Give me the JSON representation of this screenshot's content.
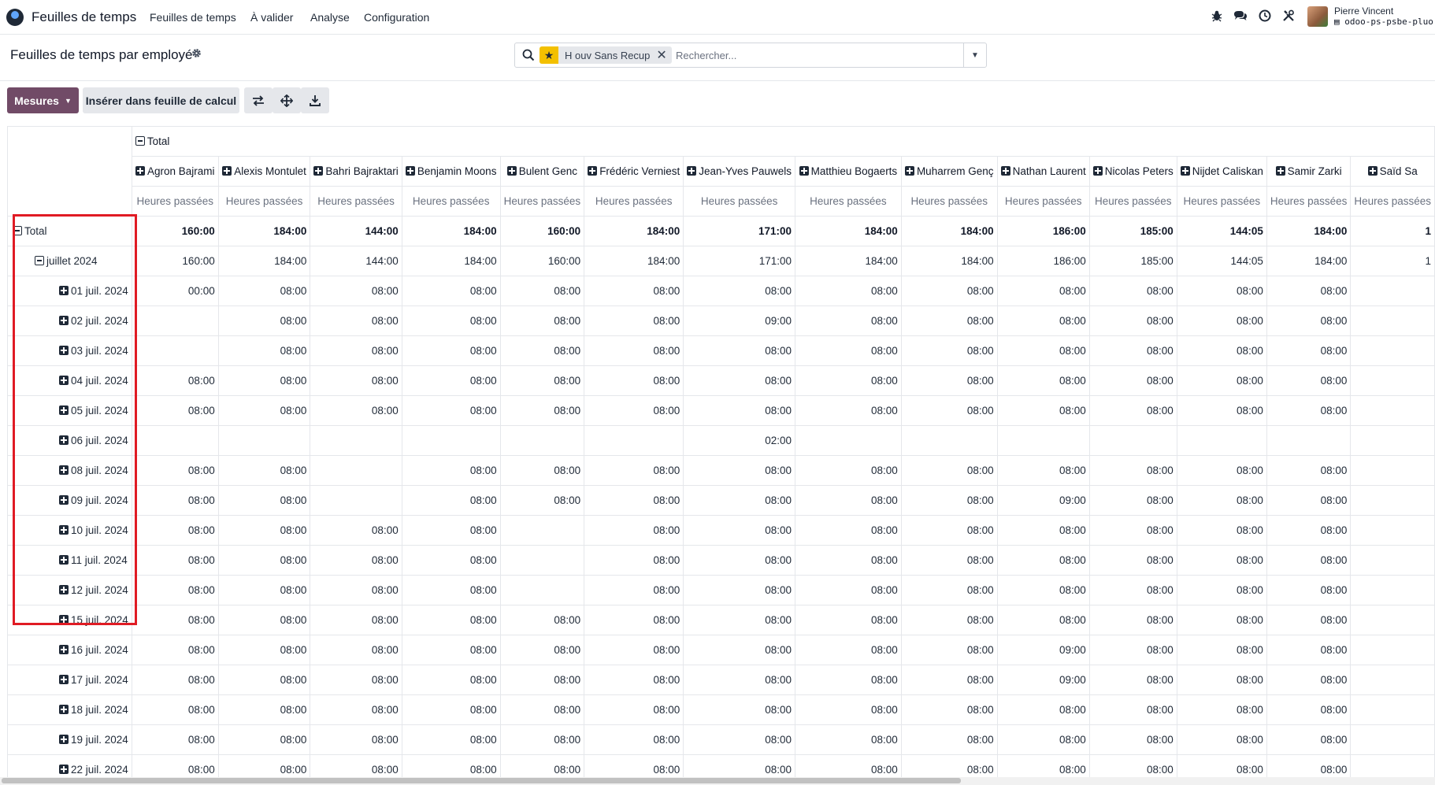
{
  "navbar": {
    "app_name": "Feuilles de temps",
    "menus": [
      "Feuilles de temps",
      "À valider",
      "Analyse",
      "Configuration"
    ],
    "user_name": "Pierre Vincent",
    "user_db": "odoo-ps-psbe-pluo",
    "db_prefix": "▤",
    "icons": [
      "bug-icon",
      "chat-icon",
      "clock-icon",
      "tools-icon"
    ]
  },
  "control_panel": {
    "title": "Feuilles de temps par employé",
    "search": {
      "facet_label": "H ouv Sans Recup",
      "placeholder": "Rechercher..."
    },
    "buttons": {
      "measures": "Mesures",
      "insert": "Insérer dans feuille de calcul"
    }
  },
  "pivot": {
    "col_total_label": "Total",
    "measure_label": "Heures passées",
    "employees": [
      "Agron Bajrami",
      "Alexis Montulet",
      "Bahri Bajraktari",
      "Benjamin Moons",
      "Bulent Genc",
      "Frédéric Verniest",
      "Jean-Yves Pauwels",
      "Matthieu Bogaerts",
      "Muharrem Genç",
      "Nathan Laurent",
      "Nicolas Peters",
      "Nijdet Caliskan",
      "Samir Zarki",
      "Saïd Sa"
    ],
    "rows": [
      {
        "label": "Total",
        "level": 0,
        "toggle": "minus",
        "values": [
          "160:00",
          "184:00",
          "144:00",
          "184:00",
          "160:00",
          "184:00",
          "171:00",
          "184:00",
          "184:00",
          "186:00",
          "185:00",
          "144:05",
          "184:00",
          "1"
        ]
      },
      {
        "label": "juillet 2024",
        "level": 1,
        "toggle": "minus",
        "values": [
          "160:00",
          "184:00",
          "144:00",
          "184:00",
          "160:00",
          "184:00",
          "171:00",
          "184:00",
          "184:00",
          "186:00",
          "185:00",
          "144:05",
          "184:00",
          "1"
        ]
      },
      {
        "label": "01 juil. 2024",
        "level": 2,
        "toggle": "plus",
        "values": [
          "00:00",
          "08:00",
          "08:00",
          "08:00",
          "08:00",
          "08:00",
          "08:00",
          "08:00",
          "08:00",
          "08:00",
          "08:00",
          "08:00",
          "08:00",
          ""
        ]
      },
      {
        "label": "02 juil. 2024",
        "level": 2,
        "toggle": "plus",
        "values": [
          "",
          "08:00",
          "08:00",
          "08:00",
          "08:00",
          "08:00",
          "09:00",
          "08:00",
          "08:00",
          "08:00",
          "08:00",
          "08:00",
          "08:00",
          ""
        ]
      },
      {
        "label": "03 juil. 2024",
        "level": 2,
        "toggle": "plus",
        "values": [
          "",
          "08:00",
          "08:00",
          "08:00",
          "08:00",
          "08:00",
          "08:00",
          "08:00",
          "08:00",
          "08:00",
          "08:00",
          "08:00",
          "08:00",
          ""
        ]
      },
      {
        "label": "04 juil. 2024",
        "level": 2,
        "toggle": "plus",
        "values": [
          "08:00",
          "08:00",
          "08:00",
          "08:00",
          "08:00",
          "08:00",
          "08:00",
          "08:00",
          "08:00",
          "08:00",
          "08:00",
          "08:00",
          "08:00",
          ""
        ]
      },
      {
        "label": "05 juil. 2024",
        "level": 2,
        "toggle": "plus",
        "values": [
          "08:00",
          "08:00",
          "08:00",
          "08:00",
          "08:00",
          "08:00",
          "08:00",
          "08:00",
          "08:00",
          "08:00",
          "08:00",
          "08:00",
          "08:00",
          ""
        ]
      },
      {
        "label": "06 juil. 2024",
        "level": 2,
        "toggle": "plus",
        "values": [
          "",
          "",
          "",
          "",
          "",
          "",
          "02:00",
          "",
          "",
          "",
          "",
          "",
          "",
          ""
        ]
      },
      {
        "label": "08 juil. 2024",
        "level": 2,
        "toggle": "plus",
        "values": [
          "08:00",
          "08:00",
          "",
          "08:00",
          "08:00",
          "08:00",
          "08:00",
          "08:00",
          "08:00",
          "08:00",
          "08:00",
          "08:00",
          "08:00",
          ""
        ]
      },
      {
        "label": "09 juil. 2024",
        "level": 2,
        "toggle": "plus",
        "values": [
          "08:00",
          "08:00",
          "",
          "08:00",
          "08:00",
          "08:00",
          "08:00",
          "08:00",
          "08:00",
          "09:00",
          "08:00",
          "08:00",
          "08:00",
          ""
        ]
      },
      {
        "label": "10 juil. 2024",
        "level": 2,
        "toggle": "plus",
        "values": [
          "08:00",
          "08:00",
          "08:00",
          "08:00",
          "",
          "08:00",
          "08:00",
          "08:00",
          "08:00",
          "08:00",
          "08:00",
          "08:00",
          "08:00",
          ""
        ]
      },
      {
        "label": "11 juil. 2024",
        "level": 2,
        "toggle": "plus",
        "values": [
          "08:00",
          "08:00",
          "08:00",
          "08:00",
          "",
          "08:00",
          "08:00",
          "08:00",
          "08:00",
          "08:00",
          "08:00",
          "08:00",
          "08:00",
          ""
        ]
      },
      {
        "label": "12 juil. 2024",
        "level": 2,
        "toggle": "plus",
        "values": [
          "08:00",
          "08:00",
          "08:00",
          "08:00",
          "",
          "08:00",
          "08:00",
          "08:00",
          "08:00",
          "08:00",
          "08:00",
          "08:00",
          "08:00",
          ""
        ]
      },
      {
        "label": "15 juil. 2024",
        "level": 2,
        "toggle": "plus",
        "values": [
          "08:00",
          "08:00",
          "08:00",
          "08:00",
          "08:00",
          "08:00",
          "08:00",
          "08:00",
          "08:00",
          "08:00",
          "08:00",
          "08:00",
          "08:00",
          ""
        ]
      },
      {
        "label": "16 juil. 2024",
        "level": 2,
        "toggle": "plus",
        "values": [
          "08:00",
          "08:00",
          "08:00",
          "08:00",
          "08:00",
          "08:00",
          "08:00",
          "08:00",
          "08:00",
          "09:00",
          "08:00",
          "08:00",
          "08:00",
          ""
        ]
      },
      {
        "label": "17 juil. 2024",
        "level": 2,
        "toggle": "plus",
        "values": [
          "08:00",
          "08:00",
          "08:00",
          "08:00",
          "08:00",
          "08:00",
          "08:00",
          "08:00",
          "08:00",
          "09:00",
          "08:00",
          "08:00",
          "08:00",
          ""
        ]
      },
      {
        "label": "18 juil. 2024",
        "level": 2,
        "toggle": "plus",
        "values": [
          "08:00",
          "08:00",
          "08:00",
          "08:00",
          "08:00",
          "08:00",
          "08:00",
          "08:00",
          "08:00",
          "08:00",
          "08:00",
          "08:00",
          "08:00",
          ""
        ]
      },
      {
        "label": "19 juil. 2024",
        "level": 2,
        "toggle": "plus",
        "values": [
          "08:00",
          "08:00",
          "08:00",
          "08:00",
          "08:00",
          "08:00",
          "08:00",
          "08:00",
          "08:00",
          "08:00",
          "08:00",
          "08:00",
          "08:00",
          ""
        ]
      },
      {
        "label": "22 juil. 2024",
        "level": 2,
        "toggle": "plus",
        "values": [
          "08:00",
          "08:00",
          "08:00",
          "08:00",
          "08:00",
          "08:00",
          "08:00",
          "08:00",
          "08:00",
          "08:00",
          "08:00",
          "08:00",
          "08:00",
          ""
        ]
      }
    ]
  },
  "colors": {
    "primary": "#714b67",
    "facet_star": "#f3c000",
    "highlight": "#e01b24"
  }
}
